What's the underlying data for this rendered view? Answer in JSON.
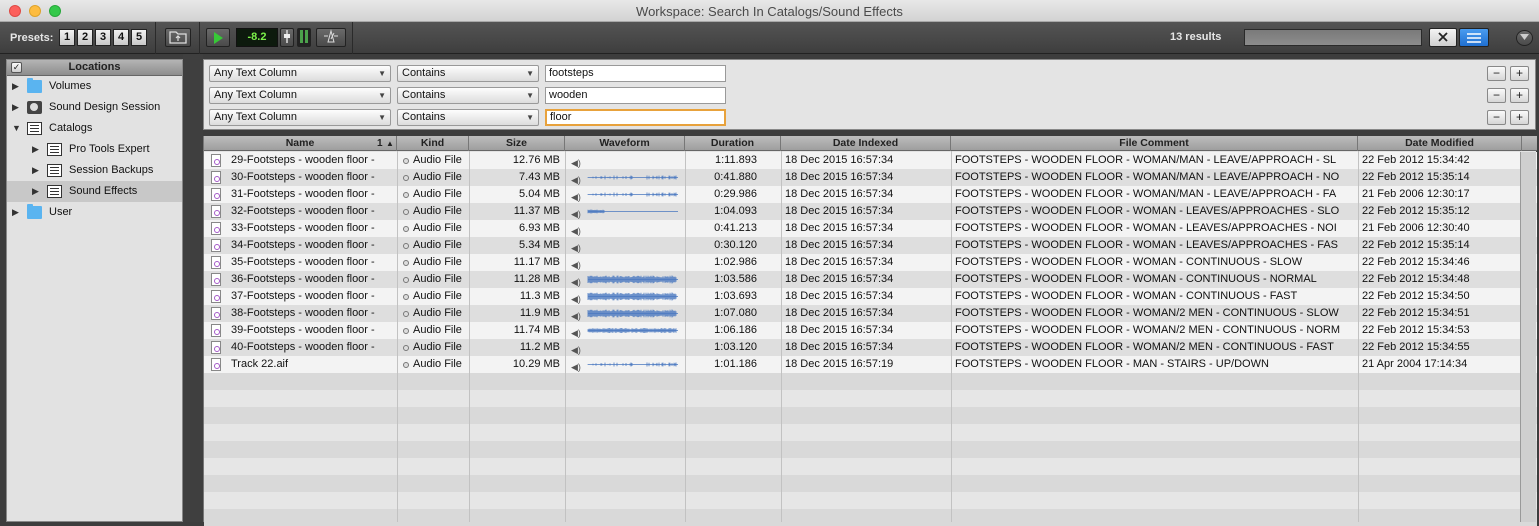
{
  "window": {
    "title": "Workspace: Search In Catalogs/Sound Effects"
  },
  "toolbar": {
    "presets_label": "Presets:",
    "presets": [
      "1",
      "2",
      "3",
      "4",
      "5"
    ],
    "level": "-8.2",
    "results_count": "13 results",
    "search_value": ""
  },
  "sidebar": {
    "header": "Locations",
    "items": [
      {
        "label": "Volumes",
        "icon": "folder-icon",
        "expanded": false,
        "indent": 0
      },
      {
        "label": "Sound Design Session",
        "icon": "session-icon",
        "expanded": false,
        "indent": 0
      },
      {
        "label": "Catalogs",
        "icon": "catalog-icon",
        "expanded": true,
        "indent": 0
      },
      {
        "label": "Pro Tools Expert",
        "icon": "catalog-icon",
        "expanded": false,
        "indent": 1
      },
      {
        "label": "Session Backups",
        "icon": "catalog-icon",
        "expanded": false,
        "indent": 1
      },
      {
        "label": "Sound Effects",
        "icon": "catalog-icon",
        "expanded": false,
        "indent": 1,
        "selected": true
      },
      {
        "label": "User",
        "icon": "folder-icon",
        "expanded": false,
        "indent": 0
      }
    ]
  },
  "criteria": [
    {
      "column": "Any Text Column",
      "operator": "Contains",
      "value": "footsteps"
    },
    {
      "column": "Any Text Column",
      "operator": "Contains",
      "value": "wooden"
    },
    {
      "column": "Any Text Column",
      "operator": "Contains",
      "value": "floor"
    }
  ],
  "table": {
    "columns": [
      "Name",
      "Kind",
      "Size",
      "Waveform",
      "Duration",
      "Date Indexed",
      "File Comment",
      "Date Modified"
    ],
    "sort_indicator": "1",
    "rows": [
      {
        "name": "29-Footsteps - wooden floor -",
        "kind": "Audio File",
        "size": "12.76 MB",
        "waveform": "none",
        "duration": "1:11.893",
        "indexed": "18 Dec 2015 16:57:34",
        "comment": "FOOTSTEPS - WOODEN FLOOR - WOMAN/MAN - LEAVE/APPROACH - SL",
        "modified": "22 Feb 2012 15:34:42"
      },
      {
        "name": "30-Footsteps - wooden floor -",
        "kind": "Audio File",
        "size": "7.43 MB",
        "waveform": "sparse",
        "duration": "0:41.880",
        "indexed": "18 Dec 2015 16:57:34",
        "comment": "FOOTSTEPS - WOODEN FLOOR - WOMAN/MAN - LEAVE/APPROACH - NO",
        "modified": "22 Feb 2012 15:35:14"
      },
      {
        "name": "31-Footsteps - wooden floor -",
        "kind": "Audio File",
        "size": "5.04 MB",
        "waveform": "sparse",
        "duration": "0:29.986",
        "indexed": "18 Dec 2015 16:57:34",
        "comment": "FOOTSTEPS - WOODEN FLOOR - WOMAN/MAN - LEAVE/APPROACH - FA",
        "modified": "21 Feb 2006 12:30:17"
      },
      {
        "name": "32-Footsteps - wooden floor -",
        "kind": "Audio File",
        "size": "11.37 MB",
        "waveform": "short",
        "duration": "1:04.093",
        "indexed": "18 Dec 2015 16:57:34",
        "comment": "FOOTSTEPS - WOODEN FLOOR - WOMAN - LEAVES/APPROACHES - SLO",
        "modified": "22 Feb 2012 15:35:12"
      },
      {
        "name": "33-Footsteps - wooden floor -",
        "kind": "Audio File",
        "size": "6.93 MB",
        "waveform": "none",
        "duration": "0:41.213",
        "indexed": "18 Dec 2015 16:57:34",
        "comment": "FOOTSTEPS - WOODEN FLOOR - WOMAN - LEAVES/APPROACHES - NOI",
        "modified": "21 Feb 2006 12:30:40"
      },
      {
        "name": "34-Footsteps - wooden floor -",
        "kind": "Audio File",
        "size": "5.34 MB",
        "waveform": "none",
        "duration": "0:30.120",
        "indexed": "18 Dec 2015 16:57:34",
        "comment": "FOOTSTEPS - WOODEN FLOOR - WOMAN - LEAVES/APPROACHES - FAS",
        "modified": "22 Feb 2012 15:35:14"
      },
      {
        "name": "35-Footsteps - wooden floor -",
        "kind": "Audio File",
        "size": "11.17 MB",
        "waveform": "none",
        "duration": "1:02.986",
        "indexed": "18 Dec 2015 16:57:34",
        "comment": "FOOTSTEPS - WOODEN FLOOR - WOMAN - CONTINUOUS - SLOW",
        "modified": "22 Feb 2012 15:34:46"
      },
      {
        "name": "36-Footsteps - wooden floor -",
        "kind": "Audio File",
        "size": "11.28 MB",
        "waveform": "dense",
        "duration": "1:03.586",
        "indexed": "18 Dec 2015 16:57:34",
        "comment": "FOOTSTEPS - WOODEN FLOOR - WOMAN - CONTINUOUS - NORMAL",
        "modified": "22 Feb 2012 15:34:48"
      },
      {
        "name": "37-Footsteps - wooden floor -",
        "kind": "Audio File",
        "size": "11.3 MB",
        "waveform": "dense",
        "duration": "1:03.693",
        "indexed": "18 Dec 2015 16:57:34",
        "comment": "FOOTSTEPS - WOODEN FLOOR - WOMAN - CONTINUOUS - FAST",
        "modified": "22 Feb 2012 15:34:50"
      },
      {
        "name": "38-Footsteps - wooden floor -",
        "kind": "Audio File",
        "size": "11.9 MB",
        "waveform": "dense",
        "duration": "1:07.080",
        "indexed": "18 Dec 2015 16:57:34",
        "comment": "FOOTSTEPS - WOODEN FLOOR - WOMAN/2 MEN - CONTINUOUS - SLOW",
        "modified": "22 Feb 2012 15:34:51"
      },
      {
        "name": "39-Footsteps - wooden floor -",
        "kind": "Audio File",
        "size": "11.74 MB",
        "waveform": "medium",
        "duration": "1:06.186",
        "indexed": "18 Dec 2015 16:57:34",
        "comment": "FOOTSTEPS - WOODEN FLOOR - WOMAN/2 MEN - CONTINUOUS - NORM",
        "modified": "22 Feb 2012 15:34:53"
      },
      {
        "name": "40-Footsteps - wooden floor -",
        "kind": "Audio File",
        "size": "11.2 MB",
        "waveform": "none",
        "duration": "1:03.120",
        "indexed": "18 Dec 2015 16:57:34",
        "comment": "FOOTSTEPS - WOODEN FLOOR - WOMAN/2 MEN - CONTINUOUS - FAST",
        "modified": "22 Feb 2012 15:34:55"
      },
      {
        "name": "Track 22.aif",
        "kind": "Audio File",
        "size": "10.29 MB",
        "waveform": "sparse",
        "duration": "1:01.186",
        "indexed": "18 Dec 2015 16:57:19",
        "comment": "FOOTSTEPS - WOODEN FLOOR - MAN - STAIRS - UP/DOWN",
        "modified": "21 Apr 2004 17:14:34"
      }
    ]
  },
  "colors": {
    "waveform": "#4a78c0",
    "level_text": "#7cf24a",
    "focus_ring": "#e8a23c"
  }
}
